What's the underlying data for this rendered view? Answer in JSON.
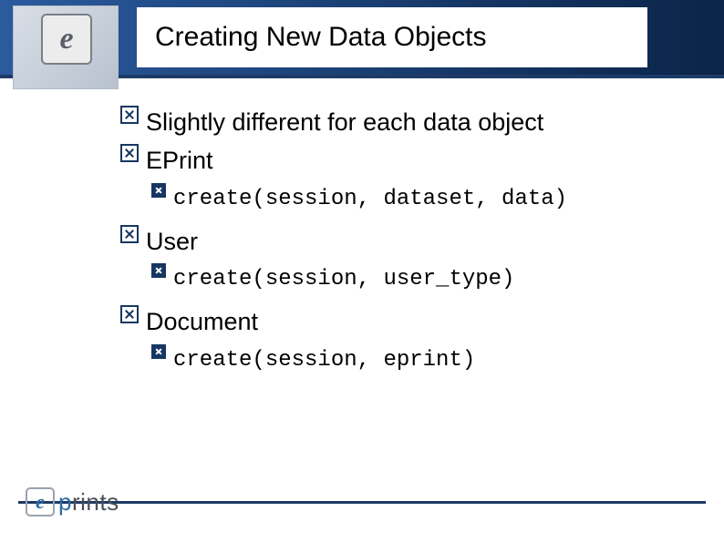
{
  "header": {
    "title": "Creating New Data Objects",
    "icon_glyph": "e"
  },
  "bullets": {
    "intro": "Slightly different for each data object",
    "eprint": {
      "label": "EPrint",
      "code": "create(session, dataset, data)"
    },
    "user": {
      "label": "User",
      "code": "create(session, user_type)"
    },
    "document": {
      "label": "Document",
      "code": "create(session, eprint)"
    }
  },
  "footer": {
    "logo_glyph": "e",
    "logo_text_p": "p",
    "logo_text_rest": "rints"
  }
}
